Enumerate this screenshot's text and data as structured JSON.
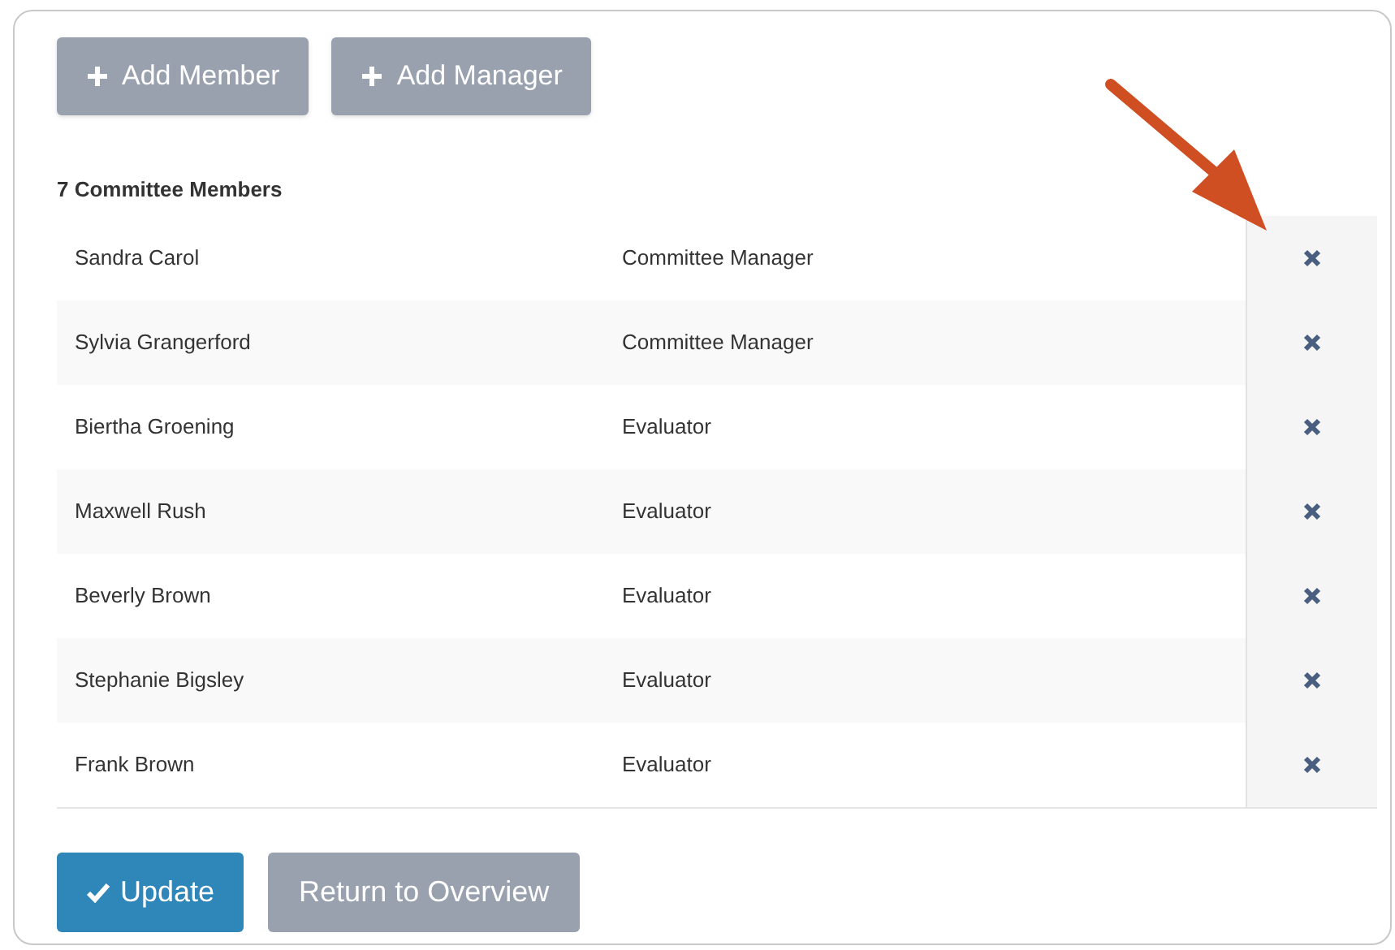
{
  "actions": [
    {
      "label": "Add Member"
    },
    {
      "label": "Add Manager"
    }
  ],
  "members_heading": "7 Committee Members",
  "members": [
    {
      "name": "Sandra Carol",
      "role": "Committee Manager"
    },
    {
      "name": "Sylvia Grangerford",
      "role": "Committee Manager"
    },
    {
      "name": "Biertha Groening",
      "role": "Evaluator"
    },
    {
      "name": "Maxwell Rush",
      "role": "Evaluator"
    },
    {
      "name": "Beverly Brown",
      "role": "Evaluator"
    },
    {
      "name": "Stephanie Bigsley",
      "role": "Evaluator"
    },
    {
      "name": "Frank Brown",
      "role": "Evaluator"
    }
  ],
  "footer_buttons": [
    {
      "label": "Update",
      "kind": "primary"
    },
    {
      "label": "Return to Overview",
      "kind": "secondary"
    }
  ]
}
